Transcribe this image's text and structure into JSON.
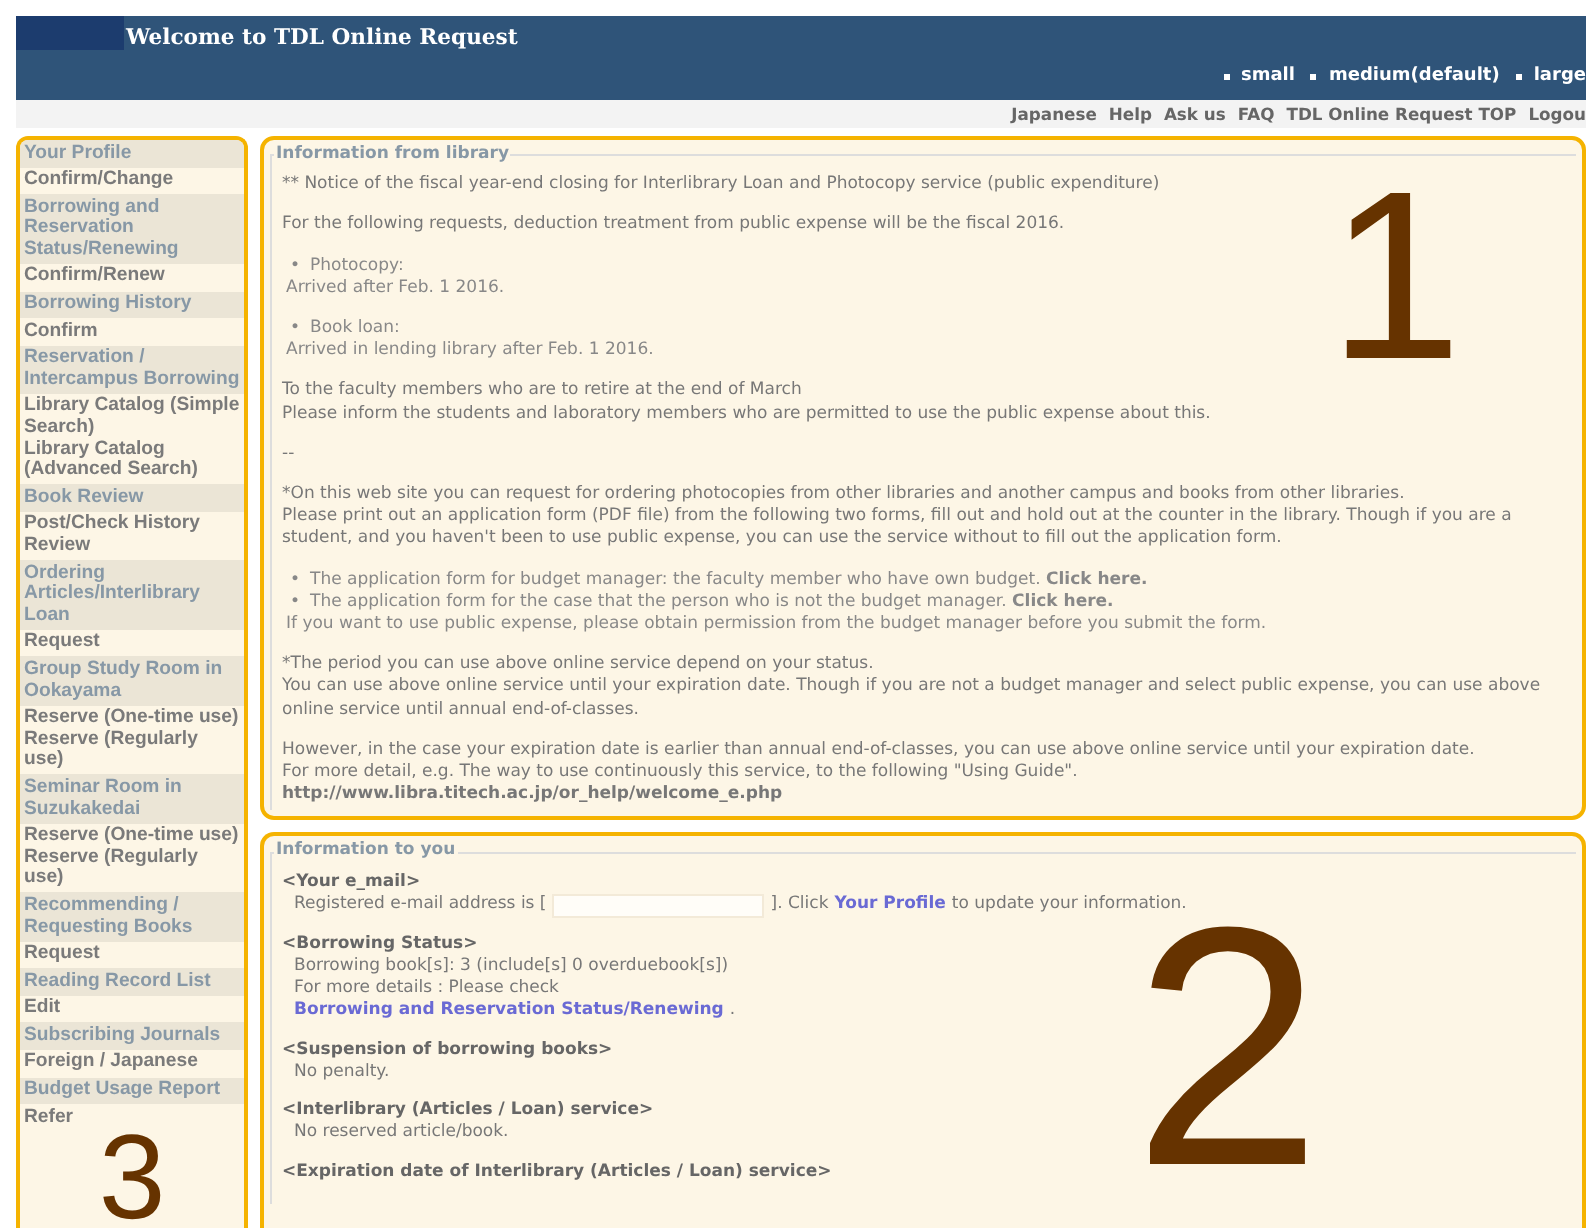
{
  "header": {
    "title": "Welcome to TDL Online Request",
    "font_sizes": [
      "small",
      "medium(default)",
      "large"
    ],
    "links": [
      "Japanese",
      "Help",
      "Ask us",
      "FAQ",
      "TDL Online Request TOP",
      "Logou"
    ]
  },
  "sidebar": {
    "sections": [
      {
        "title": "Your Profile",
        "links": [
          "Confirm/Change"
        ]
      },
      {
        "title": "Borrowing and Reservation Status/Renewing",
        "links": [
          "Confirm/Renew"
        ]
      },
      {
        "title": "Borrowing History",
        "links": [
          "Confirm"
        ]
      },
      {
        "title": "Reservation / Intercampus Borrowing",
        "links": [
          "Library Catalog (Simple Search)",
          "Library Catalog (Advanced Search)"
        ]
      },
      {
        "title": "Book Review",
        "links": [
          "Post/Check History Review"
        ]
      },
      {
        "title": "Ordering Articles/Interlibrary Loan",
        "links": [
          "Request"
        ]
      },
      {
        "title": "Group Study Room in Ookayama",
        "links": [
          "Reserve (One-time use)",
          "Reserve (Regularly use)"
        ]
      },
      {
        "title": "Seminar Room in Suzukakedai",
        "links": [
          "Reserve (One-time use)",
          "Reserve (Regularly use)"
        ]
      },
      {
        "title": "Recommending / Requesting Books",
        "links": [
          "Request"
        ]
      },
      {
        "title": "Reading Record List",
        "links": [
          "Edit"
        ]
      },
      {
        "title": "Subscribing Journals",
        "links": [
          "Foreign / Japanese"
        ]
      },
      {
        "title": "Budget Usage Report",
        "links": [
          "Refer"
        ]
      }
    ]
  },
  "library_info": {
    "legend": "Information from library",
    "blocks": [
      {
        "kind": "para",
        "lines": [
          "** Notice of the fiscal year-end closing for Interlibrary Loan and Photocopy service (public expenditure)"
        ]
      },
      {
        "kind": "para",
        "lines": [
          "For the following requests, deduction treatment from public expense will be the fiscal 2016."
        ]
      },
      {
        "kind": "bullet",
        "marker": "•",
        "label": "Photocopy:",
        "note": "Arrived after Feb. 1 2016."
      },
      {
        "kind": "bullet",
        "marker": "•",
        "label": "Book loan:",
        "note": "Arrived in lending library after Feb. 1 2016."
      },
      {
        "kind": "para",
        "lines": [
          "To the faculty members who are to retire at the end of March",
          "Please inform the students and laboratory members who are permitted to use the public expense about this."
        ]
      },
      {
        "kind": "para",
        "lines": [
          "--"
        ]
      },
      {
        "kind": "para",
        "lines": [
          "*On this web site you can request for ordering photocopies from other libraries and another campus and books from other libraries.",
          "Please print out an application form (PDF file) from the following two forms, fill out and hold out at the counter in the library. Though if you are a student, and you haven't been to use public expense, you can use the service without to fill out the application form."
        ]
      },
      {
        "kind": "forms",
        "items": [
          {
            "marker": "•",
            "text": "The application form for budget manager: the faculty member who have own budget.",
            "link": "Click here."
          },
          {
            "marker": "•",
            "text": "The application form for the case that the person who is not the budget manager.",
            "link": "Click here."
          }
        ],
        "note": "If you want to use public expense, please obtain permission from the budget manager before you submit the form."
      },
      {
        "kind": "para",
        "lines": [
          "*The period you can use above online service depend on your status.",
          "You can use above online service until your expiration date. Though if you are not a budget manager and select public expense, you can use above online service until annual end-of-classes."
        ]
      },
      {
        "kind": "url",
        "lines": [
          "However, in the case your expiration date is earlier than annual end-of-classes, you can use above online service until your expiration date.",
          "For more detail, e.g. The way to use continuously this service, to the following \"Using Guide\"."
        ],
        "url": "http://www.libra.titech.ac.jp/or_help/welcome_e.php"
      }
    ]
  },
  "user_info": {
    "legend": "Information to you",
    "sections": [
      {
        "kind": "email",
        "heading": "<Your e_mail>",
        "before": "Registered e-mail address is [",
        "after": "]. Click",
        "link": "Your Profile",
        "tail": "to update your information."
      },
      {
        "kind": "status",
        "heading": "<Borrowing Status>",
        "lines": [
          "Borrowing book[s]: 3 (include[s] 0 overduebook[s])",
          "For more details : Please check"
        ],
        "link": "Borrowing and Reservation Status/Renewing",
        "tail": "."
      },
      {
        "kind": "text",
        "heading": "<Suspension of borrowing books>",
        "lines": [
          "No penalty."
        ]
      },
      {
        "kind": "text",
        "heading": "<Interlibrary (Articles / Loan) service>",
        "lines": [
          "No reserved article/book."
        ]
      },
      {
        "kind": "text",
        "heading": "<Expiration date of Interlibrary (Articles / Loan) service>"
      }
    ]
  },
  "annotations": [
    "1",
    "2",
    "3"
  ]
}
